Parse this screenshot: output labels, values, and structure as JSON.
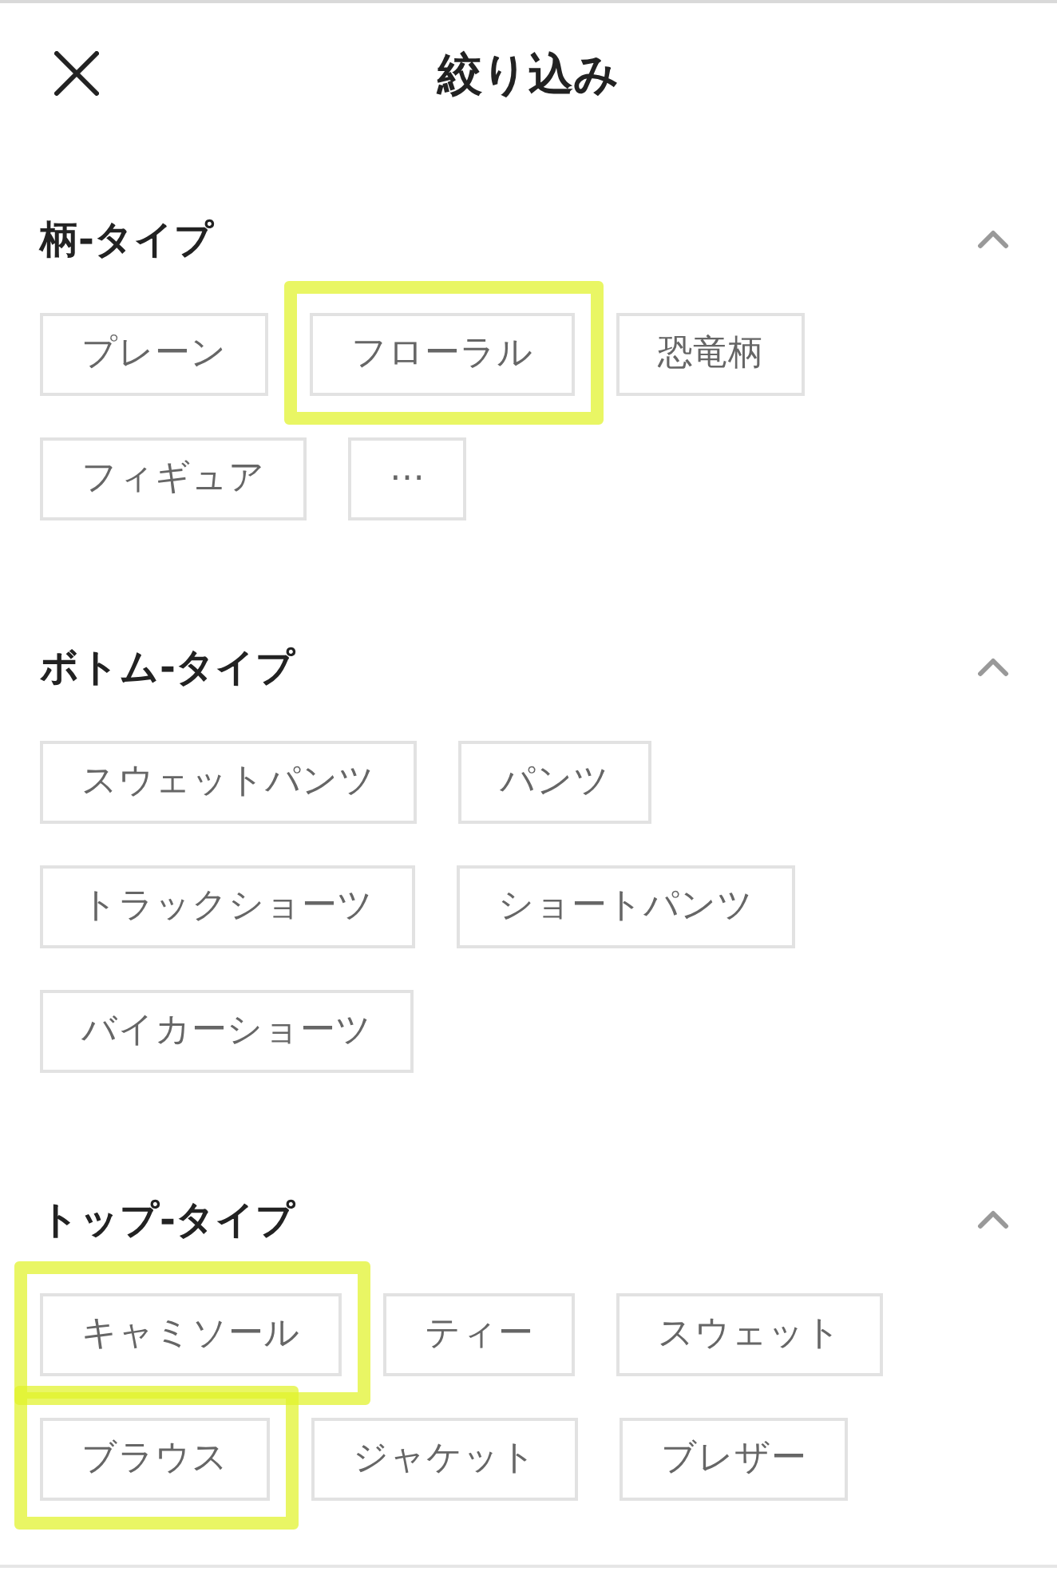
{
  "header": {
    "title": "絞り込み"
  },
  "sections": [
    {
      "title": "柄-タイプ",
      "expanded": true,
      "options": [
        {
          "label": "プレーン",
          "selected": false,
          "highlighted": false
        },
        {
          "label": "フローラル",
          "selected": false,
          "highlighted": true
        },
        {
          "label": "恐竜柄",
          "selected": false,
          "highlighted": false
        },
        {
          "label": "フィギュア",
          "selected": false,
          "highlighted": false
        },
        {
          "label": "⋯",
          "selected": false,
          "highlighted": false
        }
      ]
    },
    {
      "title": "ボトム-タイプ",
      "expanded": true,
      "options": [
        {
          "label": "スウェットパンツ",
          "selected": false,
          "highlighted": false
        },
        {
          "label": "パンツ",
          "selected": false,
          "highlighted": false
        },
        {
          "label": "トラックショーツ",
          "selected": false,
          "highlighted": false
        },
        {
          "label": "ショートパンツ",
          "selected": false,
          "highlighted": false
        },
        {
          "label": "バイカーショーツ",
          "selected": false,
          "highlighted": false
        }
      ]
    },
    {
      "title": "トップ-タイプ",
      "expanded": true,
      "options": [
        {
          "label": "キャミソール",
          "selected": false,
          "highlighted": true
        },
        {
          "label": "ティー",
          "selected": false,
          "highlighted": false
        },
        {
          "label": "スウェット",
          "selected": false,
          "highlighted": false
        },
        {
          "label": "ブラウス",
          "selected": false,
          "highlighted": true
        },
        {
          "label": "ジャケット",
          "selected": false,
          "highlighted": false
        },
        {
          "label": "ブレザー",
          "selected": false,
          "highlighted": false
        }
      ]
    }
  ]
}
